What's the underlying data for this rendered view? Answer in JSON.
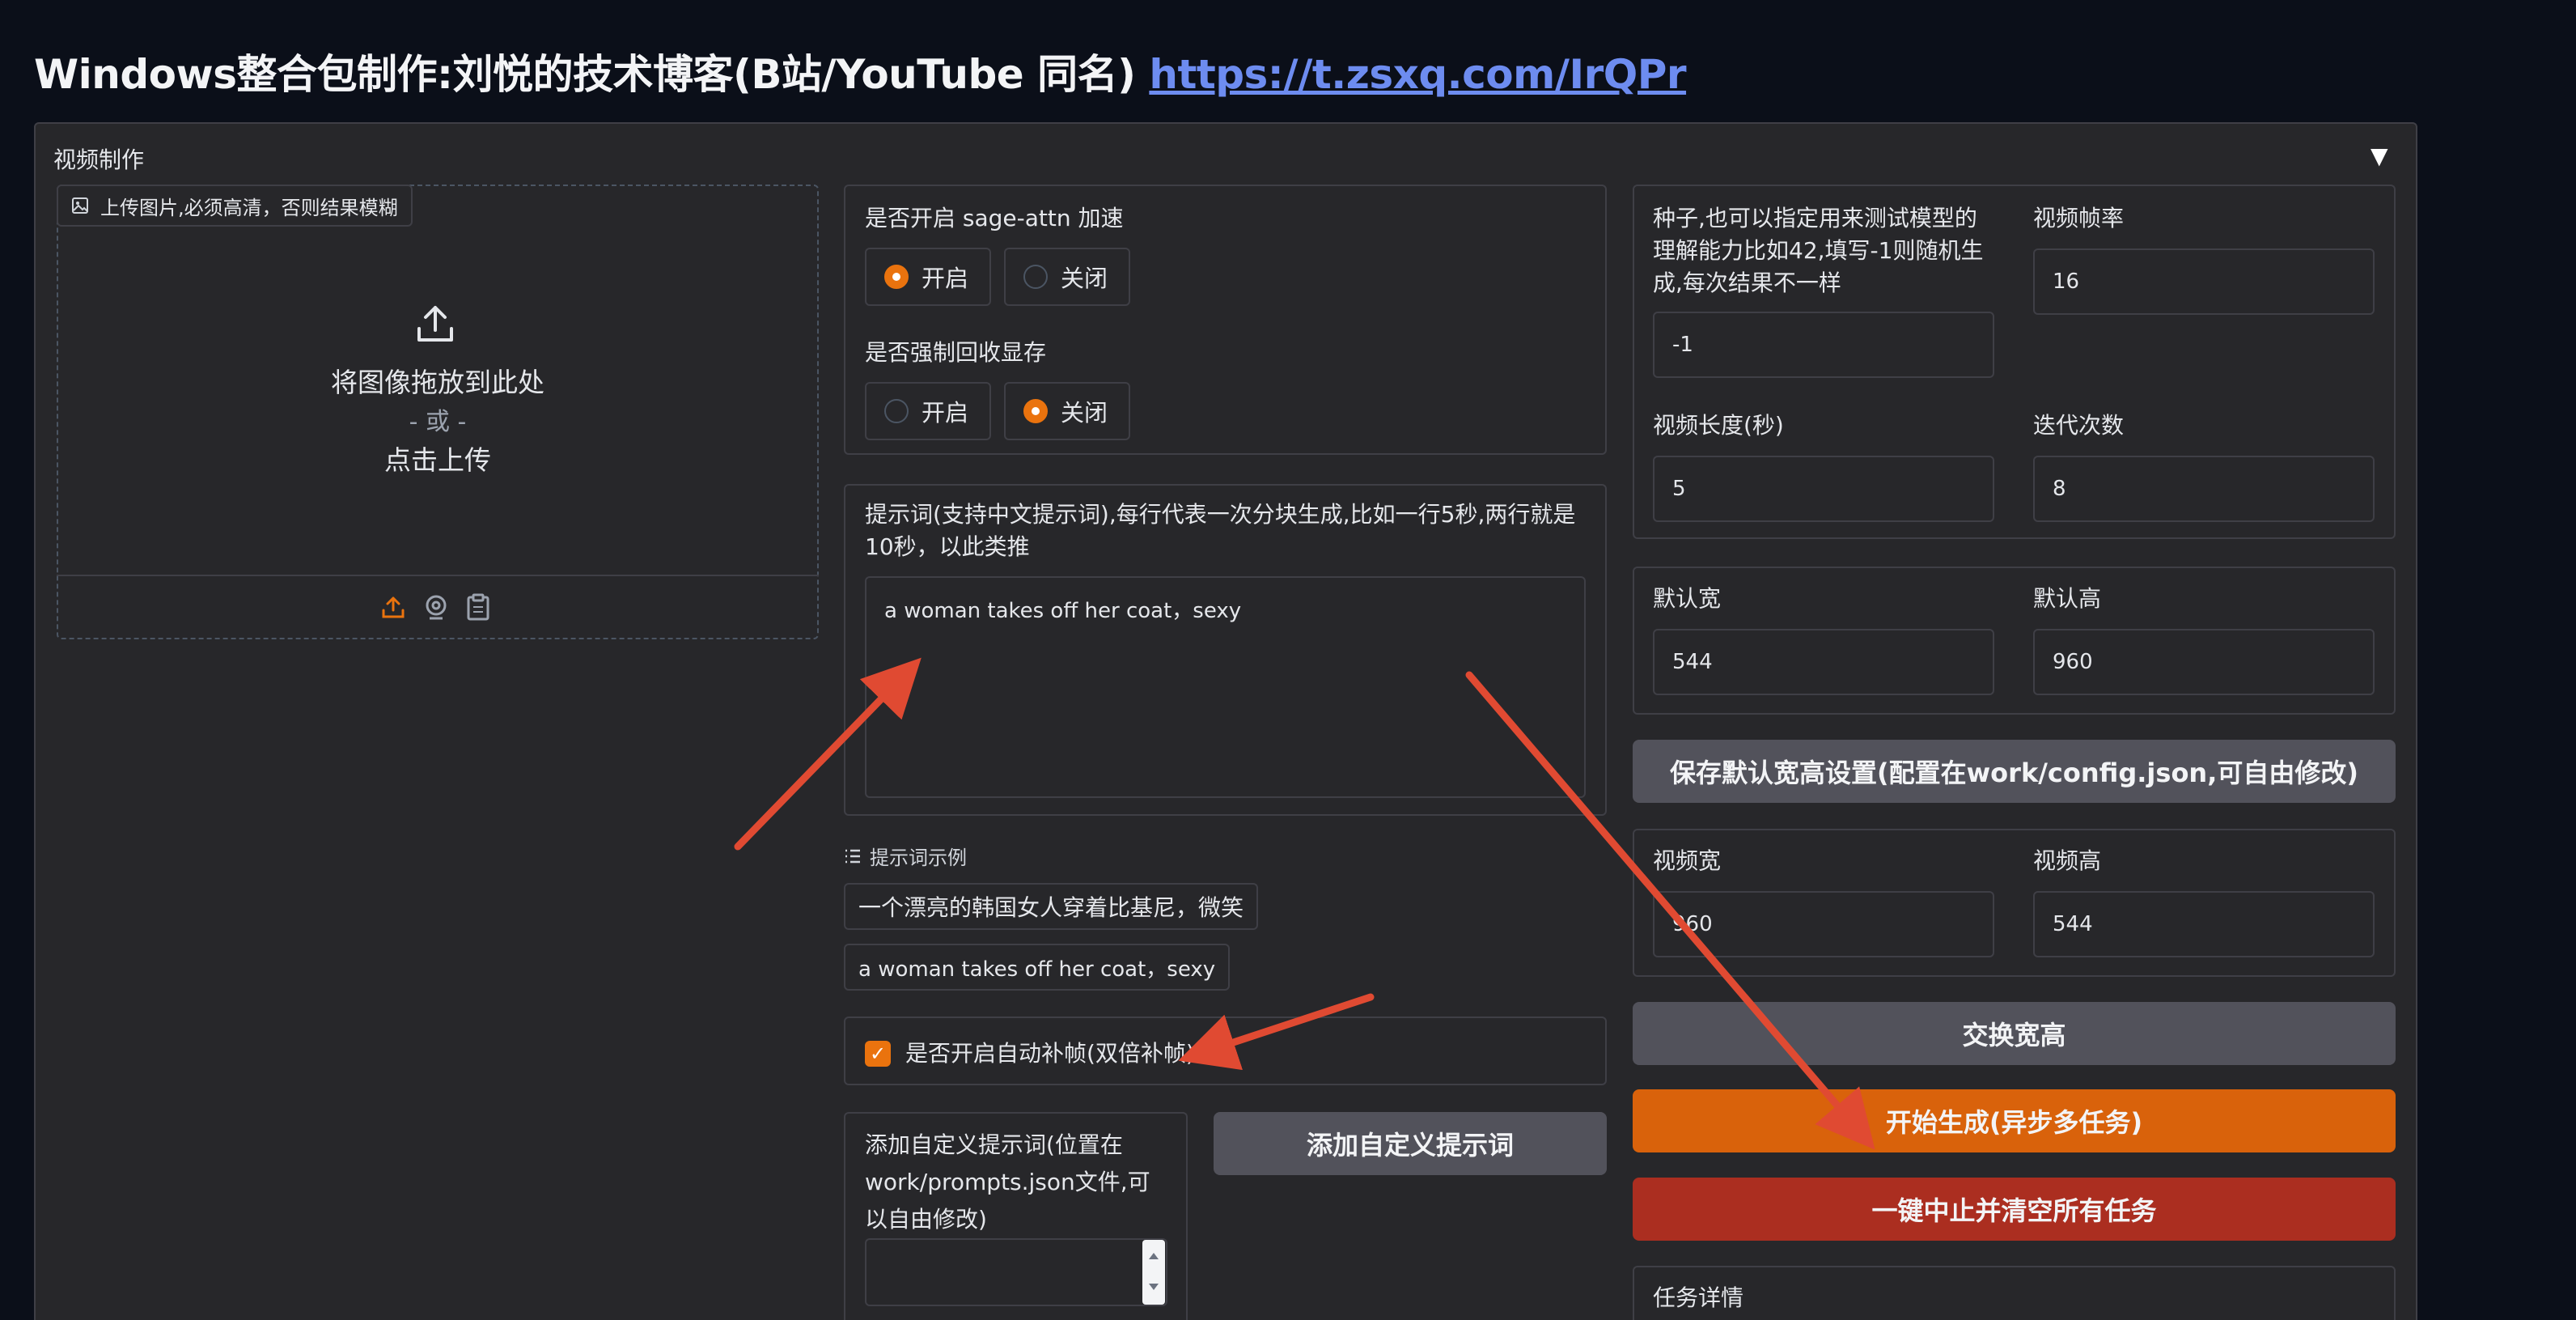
{
  "header": {
    "title": "Windows整合包制作:刘悦的技术博客(B站/YouTube 同名)",
    "link": "https://t.zsxq.com/IrQPr"
  },
  "accordion": {
    "title": "视频制作",
    "arrow": "▼"
  },
  "upload": {
    "label": "上传图片,必须高清，否则结果模糊",
    "drop_text": "将图像拖放到此处",
    "or_text": "- 或 -",
    "click_text": "点击上传"
  },
  "sage": {
    "label": "是否开启 sage-attn 加速",
    "options": [
      "开启",
      "关闭"
    ],
    "selected": "开启"
  },
  "vram": {
    "label": "是否强制回收显存",
    "options": [
      "开启",
      "关闭"
    ],
    "selected": "关闭"
  },
  "prompt": {
    "label": "提示词(支持中文提示词),每行代表一次分块生成,比如一行5秒,两行就是10秒，以此类推",
    "value": "a woman takes off her coat，sexy"
  },
  "examples": {
    "label": "提示词示例",
    "items": [
      "一个漂亮的韩国女人穿着比基尼，微笑",
      "a woman takes off her coat，sexy"
    ]
  },
  "interp": {
    "label": "是否开启自动补帧(双倍补帧)",
    "checked": true
  },
  "custom_prompt": {
    "label": "添加自定义提示词(位置在work/prompts.json文件,可以自由修改)",
    "value": "",
    "button": "添加自定义提示词"
  },
  "settings": {
    "seed_label": "种子,也可以指定用来测试模型的理解能力比如42,填写-1则随机生成,每次结果不一样",
    "seed_value": "-1",
    "fps_label": "视频帧率",
    "fps_value": "16",
    "length_label": "视频长度(秒)",
    "length_value": "5",
    "steps_label": "迭代次数",
    "steps_value": "8",
    "default_w_label": "默认宽",
    "default_w_value": "544",
    "default_h_label": "默认高",
    "default_h_value": "960",
    "save_button": "保存默认宽高设置(配置在work/config.json,可自由修改)",
    "video_w_label": "视频宽",
    "video_w_value": "960",
    "video_h_label": "视频高",
    "video_h_value": "544",
    "swap_button": "交换宽高",
    "start_button": "开始生成(异步多任务)",
    "stop_button": "一键中止并清空所有任务",
    "task_label": "任务详情"
  },
  "colors": {
    "accent": "#ea730e",
    "link": "#6d8cf0",
    "stop": "#ab2e20",
    "arrow": "#e04a32"
  }
}
